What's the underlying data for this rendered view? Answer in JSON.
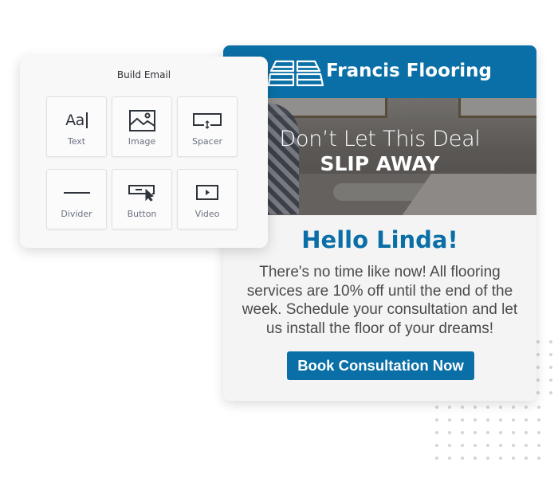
{
  "build_panel": {
    "title": "Build Email",
    "tiles": [
      {
        "label": "Text",
        "icon": "text-icon"
      },
      {
        "label": "Image",
        "icon": "image-icon"
      },
      {
        "label": "Spacer",
        "icon": "spacer-icon"
      },
      {
        "label": "Divider",
        "icon": "divider-icon"
      },
      {
        "label": "Button",
        "icon": "button-icon"
      },
      {
        "label": "Video",
        "icon": "video-icon"
      }
    ],
    "text_icon_glyph": "Aa"
  },
  "email": {
    "brand_name": "Francis Flooring",
    "brand_color": "#0a6fa6",
    "hero": {
      "line1": "Don’t Let This Deal",
      "line2": "SLIP AWAY"
    },
    "greeting": "Hello Linda!",
    "body": "There's no time like now! All flooring services are 10% off until the end of the week. Schedule your consultation and let us install the floor of your dreams!",
    "cta_label": "Book Consultation Now"
  }
}
